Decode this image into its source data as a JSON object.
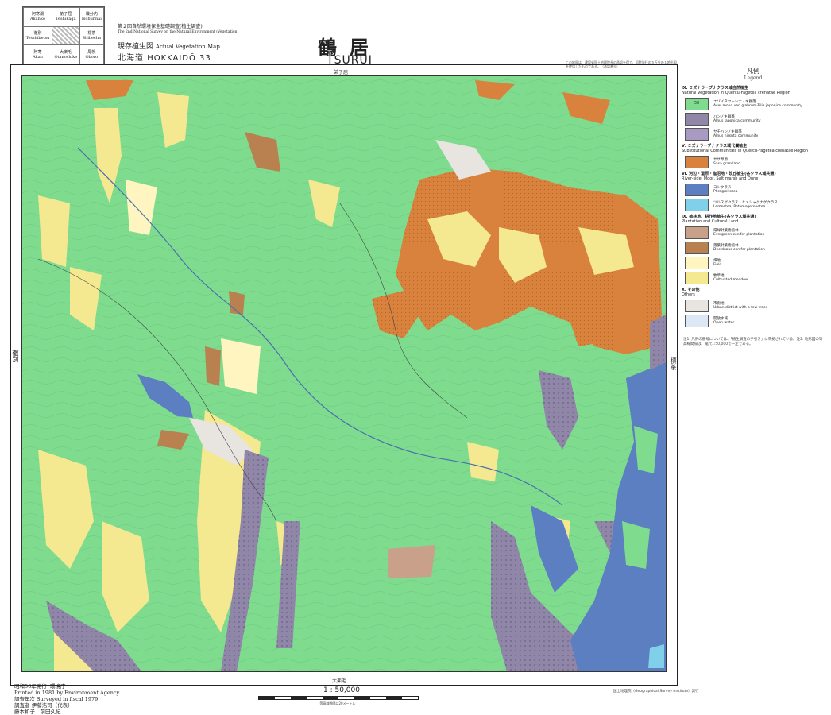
{
  "index_sheets": [
    {
      "jp": "阿寒湖",
      "en": "Akanko"
    },
    {
      "jp": "弟子屈",
      "en": "Teshikaga"
    },
    {
      "jp": "磯分内",
      "en": "Isobunnai"
    },
    {
      "jp": "徹別",
      "en": "Tesshibetsu"
    },
    {
      "jp": "",
      "en": ""
    },
    {
      "jp": "標茶",
      "en": "Shibecha"
    },
    {
      "jp": "阿寒",
      "en": "Akan"
    },
    {
      "jp": "大楽毛",
      "en": "Otanoshike"
    },
    {
      "jp": "尾幌",
      "en": "Oboro"
    }
  ],
  "header": {
    "survey_jp": "第２回自然環境保全基礎調査(植生調査)",
    "survey_en": "The 2nd National Survey on the Natural Environment (Vegetation)",
    "map_type_jp": "現存植生図",
    "map_type_en": "Actual Vegetation Map",
    "region_jp": "北海道",
    "region_en": "HOKKAIDŌ 33",
    "title_jp": "鶴居",
    "title_en": "TSURUI",
    "note": "この地図は、建設省国土地理院長の承認を得て、同院発行の５万分の１地形図を使用したものである。（承認番号）"
  },
  "map_edges": {
    "top": "弟子屈",
    "bottom": "大楽毛",
    "left": "徹別",
    "right": "標茶"
  },
  "legend": {
    "title_jp": "凡例",
    "title_en": "Legend",
    "sections": [
      {
        "heading_jp": "Ⅸ. ミズナラーブナクラス域自然植生",
        "heading_en": "Natural Vegetation in Quercu-Fagetea crenatae Region",
        "items": [
          {
            "code": "58",
            "jp": "エゾイタヤーシナノキ群落",
            "en": "Acer mono var. glabrum-Tilia japonica community",
            "color": "#7fdc8f"
          },
          {
            "code": "",
            "jp": "ハンノキ群落",
            "en": "Alnus japonica community",
            "color": "#8f86a8"
          },
          {
            "code": "",
            "jp": "ヤチハンノキ群落",
            "en": "Alnus hirsuta community",
            "color": "#a89ac0"
          }
        ]
      },
      {
        "heading_jp": "Ⅴ. ミズナラーブナクラス域代償植生",
        "heading_en": "Substitutional Communities in Quercu-Fagetea crenatae Region",
        "items": [
          {
            "code": "",
            "jp": "ササ草原",
            "en": "Sasa grassland",
            "color": "#d9823d"
          }
        ]
      },
      {
        "heading_jp": "Ⅵ. 河辺・湿原・塩沼地・砂丘植生(各クラス域共通)",
        "heading_en": "River-side, Moor, Salt marsh and Dune",
        "items": [
          {
            "code": "",
            "jp": "ヨシクラス",
            "en": "Phragmitetea",
            "color": "#5b7fc0"
          },
          {
            "code": "",
            "jp": "ツルスゲクラス・ヒメシャクナゲクラス",
            "en": "Lemnetea, Potamogetonetea",
            "color": "#7fd0e8"
          }
        ]
      },
      {
        "heading_jp": "Ⅸ. 植林地、耕作地植生(各クラス域共通)",
        "heading_en": "Plantation and Cultural Land",
        "items": [
          {
            "code": "",
            "jp": "常緑針葉樹植林",
            "en": "Evergreen conifer plantation",
            "color": "#c9a08a"
          },
          {
            "code": "",
            "jp": "落葉針葉樹植林",
            "en": "Deciduous conifer plantation",
            "color": "#b98050"
          },
          {
            "code": "",
            "jp": "畑地",
            "en": "Field",
            "color": "#fff5c0"
          },
          {
            "code": "",
            "jp": "牧草地",
            "en": "Cultivated meadow",
            "color": "#f4e890"
          }
        ]
      },
      {
        "heading_jp": "Ⅹ. その他",
        "heading_en": "Others",
        "items": [
          {
            "code": "",
            "jp": "市街地",
            "en": "Urban district with a few trees",
            "color": "#e8e4e0"
          },
          {
            "code": "",
            "jp": "開放水域",
            "en": "Open water",
            "color": "#dde8f6"
          }
        ]
      }
    ],
    "notes": "注1. 凡例の番号については、「植生調査の手引き」に準拠されている。注2. 地形図の等高線間隔は、縮尺1:50,000で一定である。"
  },
  "footer": {
    "issued_jp": "昭和56年発行",
    "agency_jp": "環境庁",
    "printed": "Printed in 1981 by Environment Agency",
    "surveyed_jp": "調査年次",
    "surveyed_en": "Surveyed in fiscal 1979",
    "researcher_jp": "調査者",
    "researcher_names": "伊藤浩司（代表）",
    "editor_names": "藤本和子　前田久紀"
  },
  "scale": {
    "ratio": "1 : 50,000",
    "label": "等高線間隔は20メートル"
  },
  "printer": "国土地理院（Geographical Survey Institute）発行"
}
